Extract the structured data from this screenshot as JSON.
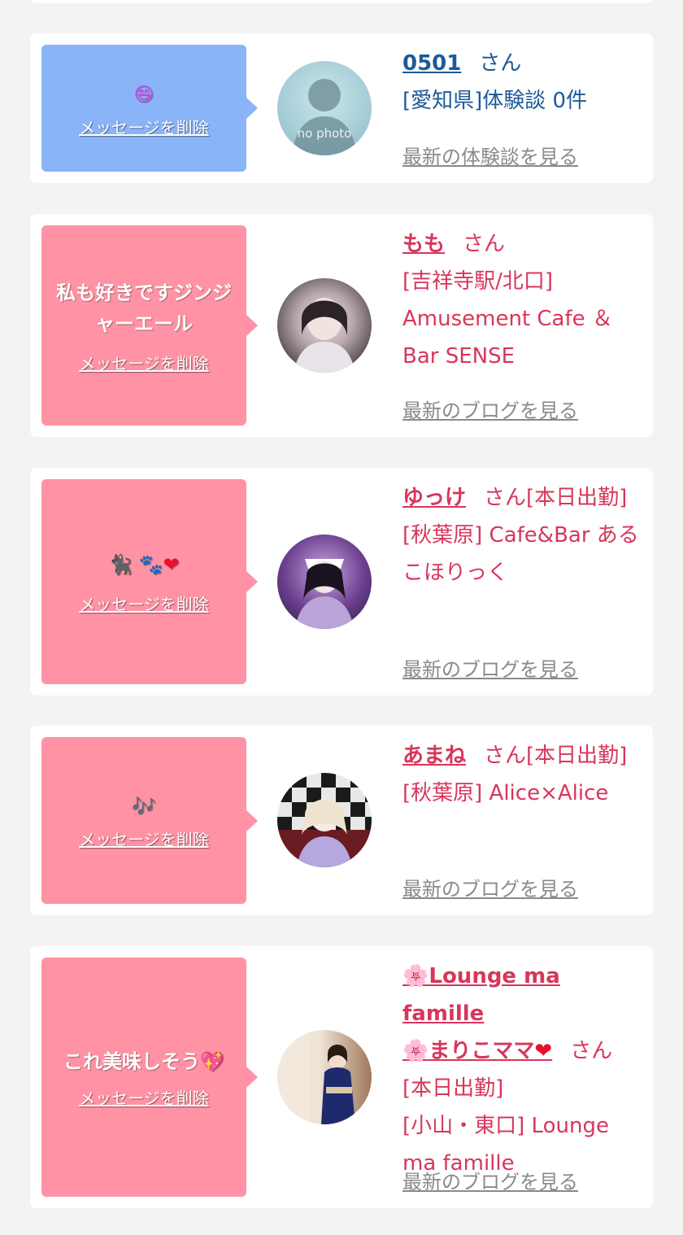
{
  "messages": [
    {
      "bubble_text": "😄",
      "delete_label": "メッセージを削除",
      "avatar_text": "no photo",
      "name": "0501",
      "san": "さん",
      "detail": "[愛知県]体験談 0件",
      "latest_link": "最新の体験談を見る"
    },
    {
      "bubble_text": "私も好きですジンジャーエール",
      "delete_label": "メッセージを削除",
      "name": "もも",
      "san": "さん",
      "detail": "[吉祥寺駅/北口] Amusement Cafe ＆Bar SENSE",
      "latest_link": "最新のブログを見る"
    },
    {
      "bubble_text": "🐈‍⬛𝅙🐾",
      "bubble_heart": "❤",
      "delete_label": "メッセージを削除",
      "name": "ゆっけ",
      "san": "さん[本日出勤]",
      "detail": "[秋葉原] Cafe&Bar あるこほりっく",
      "latest_link": "最新のブログを見る"
    },
    {
      "bubble_text": "🎶",
      "delete_label": "メッセージを削除",
      "name": "あまね",
      "san": "さん[本日出勤]",
      "detail": "[秋葉原] Alice×Alice",
      "latest_link": "最新のブログを見る"
    },
    {
      "bubble_text": "これ美味しそう",
      "bubble_heart": "💖",
      "delete_label": "メッセージを削除",
      "name_prefix": "🌸",
      "name_line1": "Lounge ma famille",
      "name_line2": "まりこママ",
      "name_heart": "❤",
      "san": "さん[本日出勤]",
      "detail": "[小山・東口] Lounge ma famille",
      "latest_link": "最新のブログを見る"
    }
  ],
  "colors": {
    "blue_bubble": "#8ab4f8",
    "pink_bubble": "#ff92a4",
    "blue_text": "#1c5a99",
    "pink_text": "#d8365a",
    "link_gray": "#8a8a8a"
  }
}
